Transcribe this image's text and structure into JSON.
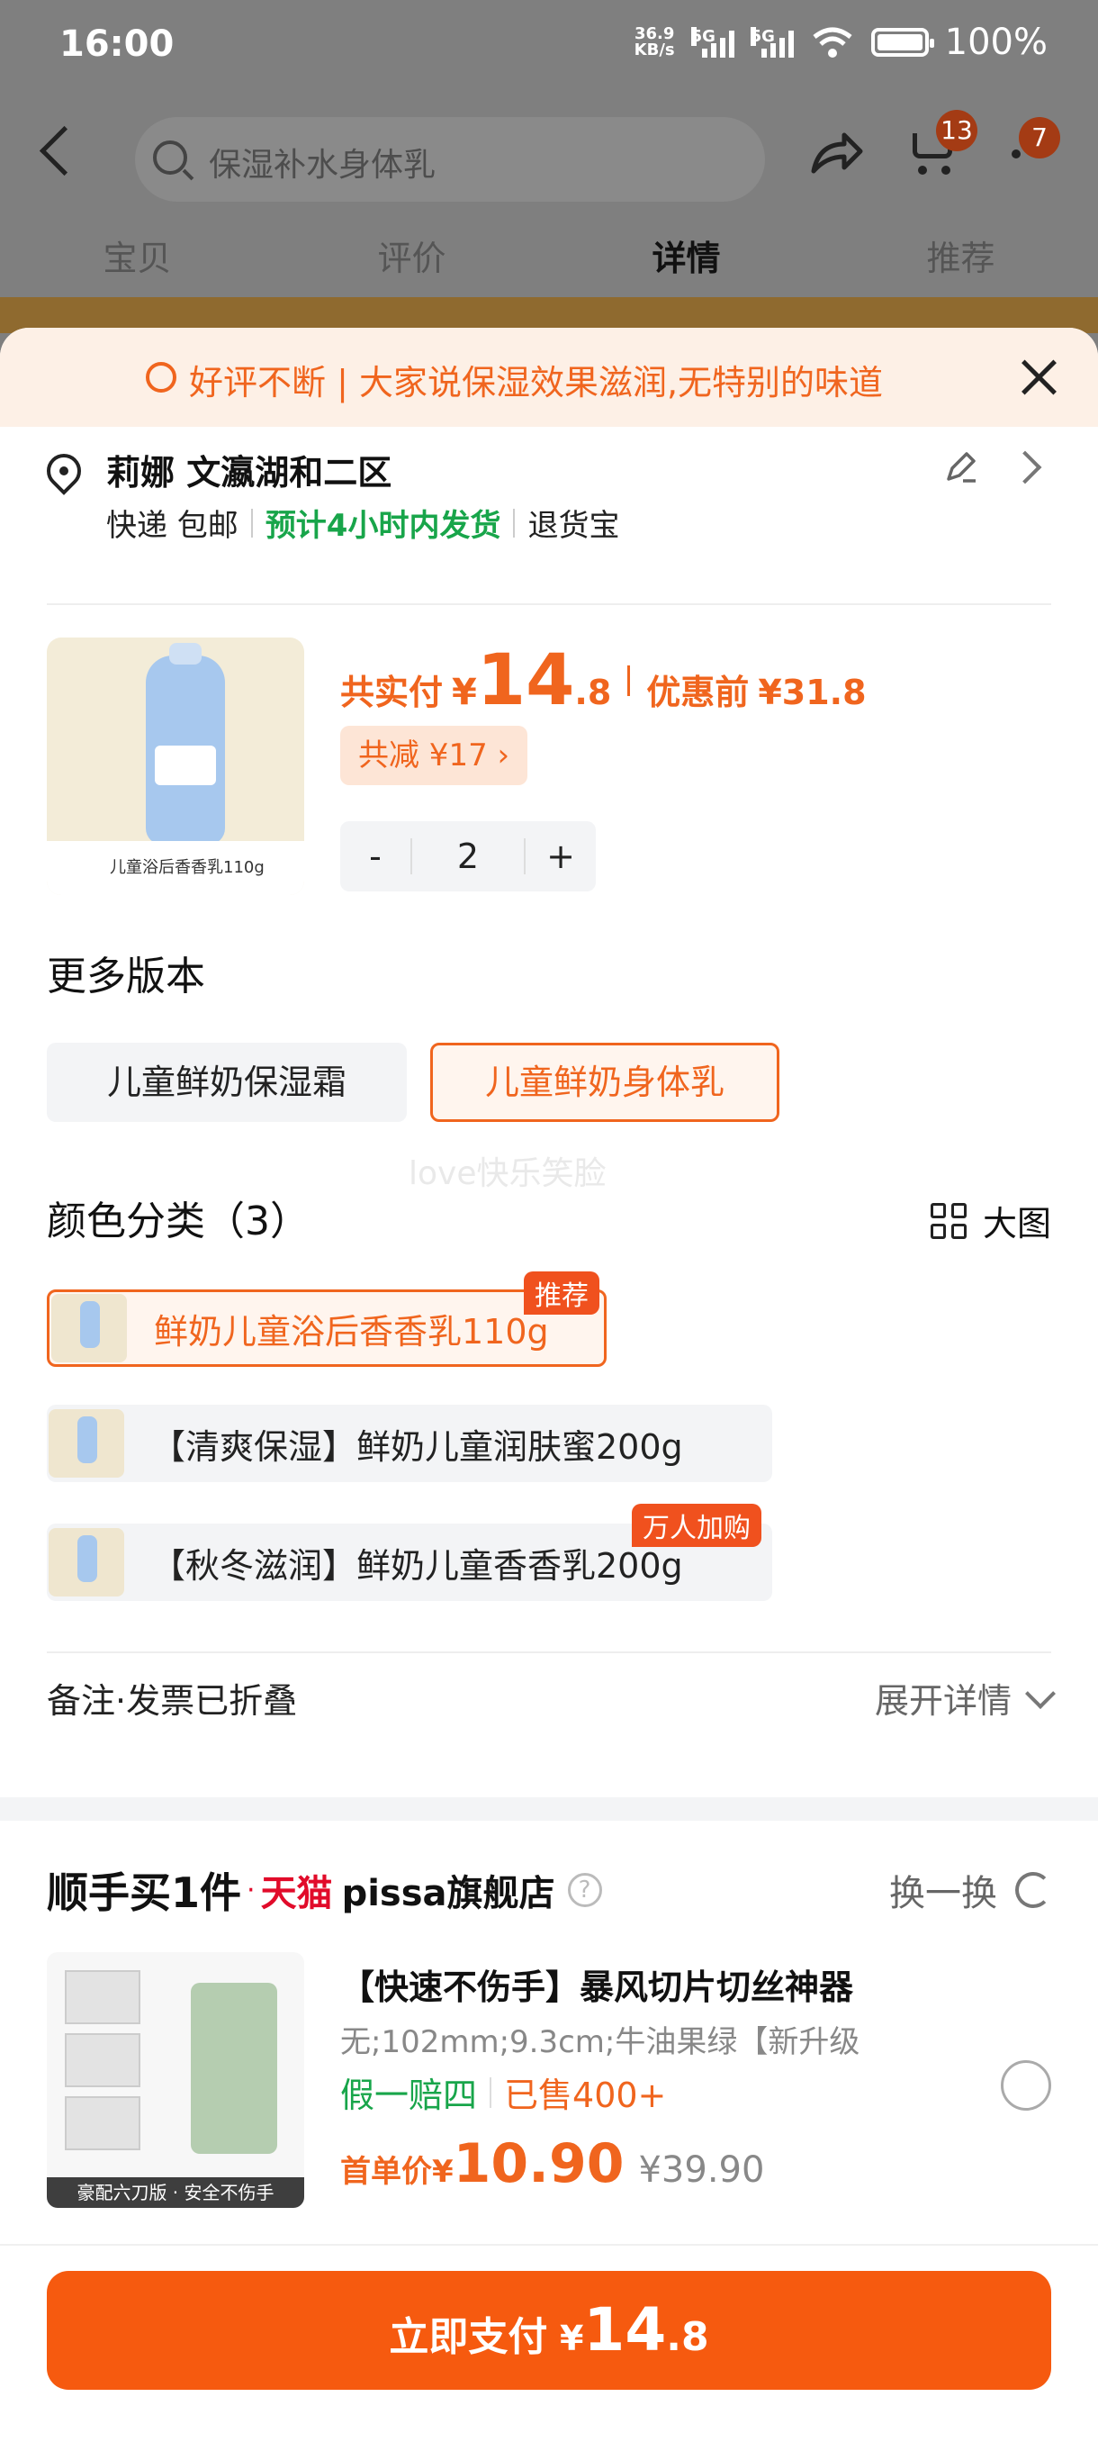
{
  "status_bar": {
    "time": "16:00",
    "net_speed_top": "36.9",
    "net_speed_bottom": "KB/s",
    "sim1": "5G",
    "sim2": "5G",
    "battery": "100%"
  },
  "header": {
    "search_placeholder": "保湿补水身体乳",
    "cart_count": "13",
    "message_count": "7"
  },
  "tabs": [
    "宝贝",
    "评价",
    "详情",
    "推荐"
  ],
  "active_tab": "详情",
  "notice": {
    "text": "好评不断 | 大家说保湿效果滋润,无特别的味道"
  },
  "address": {
    "name": "莉娜 文瀛湖和二区",
    "delivery": "快递 包邮",
    "ship_time": "预计4小时内发货",
    "return": "退货宝"
  },
  "product": {
    "image_caption": "儿童浴后香香乳110g",
    "pay_label": "共实付",
    "currency": "¥",
    "price_int": "14",
    "price_dec": ".8",
    "before_label": "优惠前",
    "before_price": "¥31.8",
    "discount": "共减 ¥17",
    "discount_chev": "›",
    "quantity": "2",
    "minus": "-",
    "plus": "+"
  },
  "versions": {
    "title": "更多版本",
    "options": [
      "儿童鲜奶保湿霜",
      "儿童鲜奶身体乳"
    ],
    "selected_index": 1
  },
  "watermark": "love快乐笑脸",
  "colors": {
    "title": "颜色分类（3）",
    "big_view": "大图",
    "items": [
      {
        "label": "鲜奶儿童浴后香香乳110g",
        "tag": "推荐"
      },
      {
        "label": "【清爽保湿】鲜奶儿童润肤蜜200g",
        "tag": ""
      },
      {
        "label": "【秋冬滋润】鲜奶儿童香香乳200g",
        "tag": "万人加购"
      }
    ],
    "selected_index": 0
  },
  "notes": {
    "label": "备注·发票已折叠",
    "expand": "展开详情"
  },
  "recommend": {
    "title": "顺手买1件",
    "platform": "天猫",
    "shop": "pissa旗舰店",
    "help": "?",
    "swap": "换一换",
    "item": {
      "image_strip": "豪配六刀版 · 安全不伤手",
      "title": "【快速不伤手】暴风切片切丝神器",
      "spec": "无;102mm;9.3cm;牛油果绿【新升级",
      "guarantee": "假一赔四",
      "sold": "已售400+",
      "price_label": "首单价¥",
      "price": "10.90",
      "original": "¥39.90"
    }
  },
  "pay_button": {
    "label": "立即支付",
    "currency": "¥",
    "int": "14",
    "dec": ".8"
  },
  "colors_theme": {
    "accent": "#f0651e",
    "green": "#18a54a",
    "tmall_red": "#e10b2a",
    "pay_button": "#f65a0f"
  }
}
